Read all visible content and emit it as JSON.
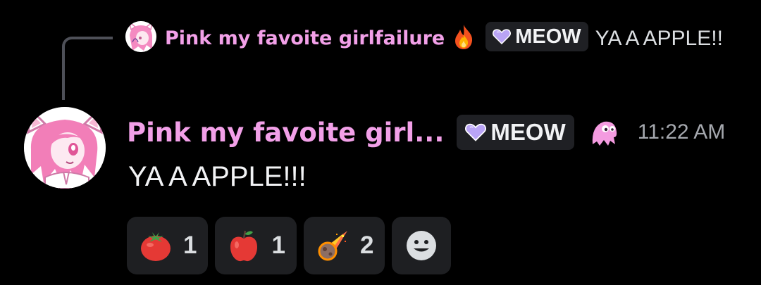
{
  "reply": {
    "author": "Pink my favoite girlfailure",
    "tag_label": "MEOW",
    "text": "YA A APPLE!!"
  },
  "message": {
    "author": "Pink my favoite girl...",
    "tag_label": "MEOW",
    "timestamp": "11:22 AM",
    "content": "YA A APPLE!!!"
  },
  "reactions": [
    {
      "emoji": "tomato-emoji",
      "count": "1"
    },
    {
      "emoji": "red-apple-emoji",
      "count": "1"
    },
    {
      "emoji": "meteor-emoji",
      "count": "2"
    }
  ],
  "colors": {
    "background": "#000000",
    "username": "#f2a0e8",
    "tag_background": "#1f2024",
    "heart": "#b9a4f5",
    "timestamp": "#a5a8ae",
    "reaction_background": "#1e1f22"
  },
  "icons": {
    "reply_badge": "fire-emoji",
    "tag": "purple-heart-icon",
    "role": "pink-ghost-icon",
    "add_reaction": "smiley-add-reaction-icon"
  }
}
